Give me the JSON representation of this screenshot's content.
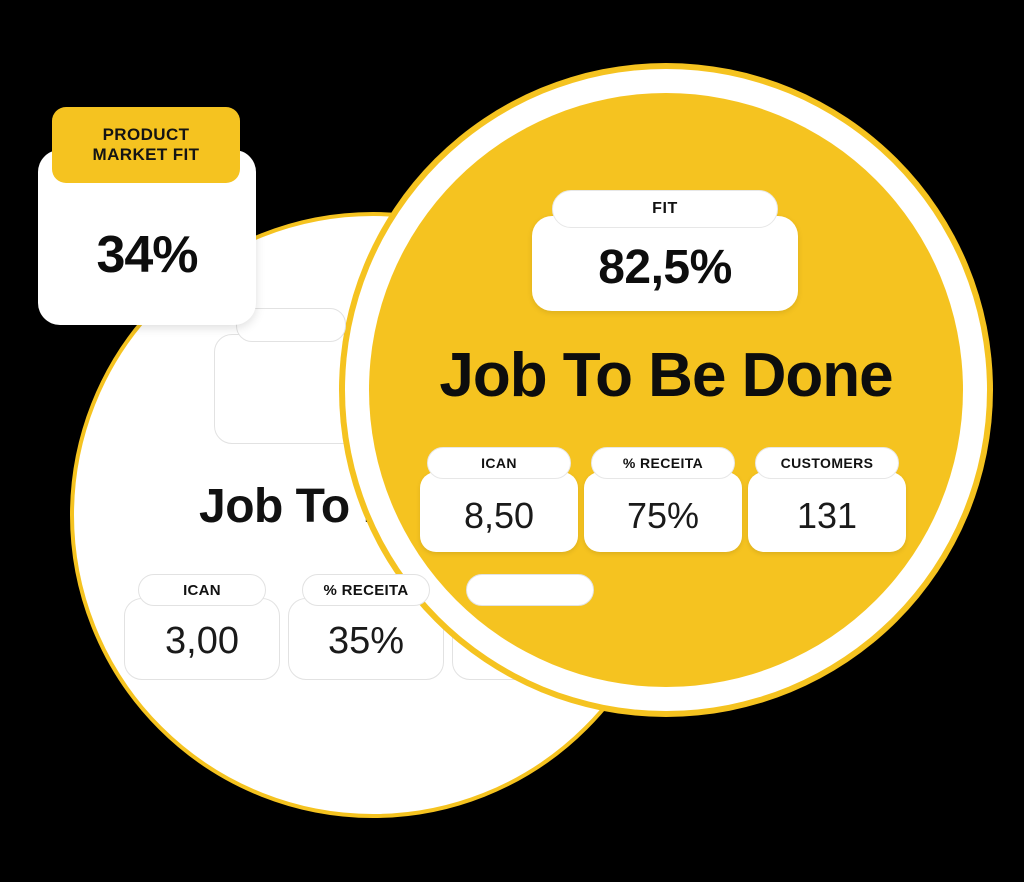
{
  "colors": {
    "brand_yellow": "#F5C320",
    "background": "#000000",
    "card_white": "#FFFFFF",
    "text_dark": "#0D0D0D"
  },
  "product_market_fit_card": {
    "badge_line1": "PRODUCT",
    "badge_line2": "MARKET FIT",
    "value": "34%"
  },
  "active_circle": {
    "fit_label": "FIT",
    "fit_value": "82,5%",
    "title": "Job To Be Done",
    "metrics": [
      {
        "label": "ICAN",
        "value": "8,50"
      },
      {
        "label": "% RECEITA",
        "value": "75%"
      },
      {
        "label": "CUSTOMERS",
        "value": "131"
      }
    ]
  },
  "background_circle": {
    "title": "Job To Be Done",
    "metrics": [
      {
        "label": "ICAN",
        "value": "3,00"
      },
      {
        "label": "% RECEITA",
        "value": "35%"
      },
      {
        "label": "",
        "value": ""
      }
    ]
  }
}
